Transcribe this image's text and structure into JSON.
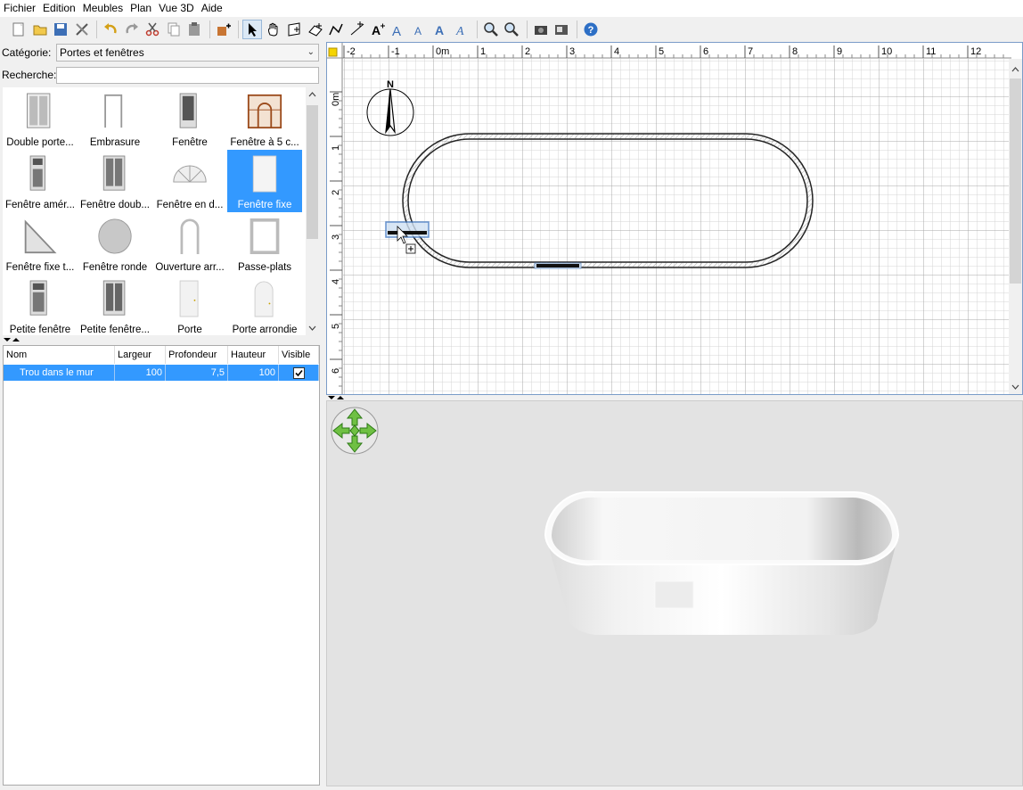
{
  "menu": [
    "Fichier",
    "Edition",
    "Meubles",
    "Plan",
    "Vue 3D",
    "Aide"
  ],
  "toolbar_icons": [
    "new-home-icon",
    "open-icon",
    "save-icon",
    "preferences-icon",
    "undo-icon",
    "redo-icon",
    "cut-icon",
    "copy-icon",
    "paste-icon",
    "add-furniture-icon",
    "select-mode-icon",
    "pan-mode-icon",
    "create-walls-icon",
    "create-rooms-icon",
    "create-polylines-icon",
    "create-dimensions-icon",
    "add-text-icon",
    "increase-text-size-icon",
    "decrease-text-size-icon",
    "bold-text-icon",
    "italic-text-icon",
    "zoom-in-icon",
    "zoom-out-icon",
    "create-photo-icon",
    "create-video-icon",
    "help-icon"
  ],
  "catalog": {
    "category_label": "Catégorie:",
    "category_value": "Portes et fenêtres",
    "search_label": "Recherche:",
    "search_value": "",
    "items": [
      {
        "label": "Double porte...",
        "selected": false
      },
      {
        "label": "Embrasure",
        "selected": false
      },
      {
        "label": "Fenêtre",
        "selected": false
      },
      {
        "label": "Fenêtre à 5 c...",
        "selected": false
      },
      {
        "label": "Fenêtre amér...",
        "selected": false
      },
      {
        "label": "Fenêtre doub...",
        "selected": false
      },
      {
        "label": "Fenêtre en d...",
        "selected": false
      },
      {
        "label": "Fenêtre fixe",
        "selected": true
      },
      {
        "label": "Fenêtre fixe t...",
        "selected": false
      },
      {
        "label": "Fenêtre ronde",
        "selected": false
      },
      {
        "label": "Ouverture arr...",
        "selected": false
      },
      {
        "label": "Passe-plats",
        "selected": false
      },
      {
        "label": "Petite fenêtre",
        "selected": false
      },
      {
        "label": "Petite fenêtre...",
        "selected": false
      },
      {
        "label": "Porte",
        "selected": false
      },
      {
        "label": "Porte arrondie",
        "selected": false
      }
    ]
  },
  "furniture_table": {
    "headers": [
      "Nom",
      "Largeur",
      "Profondeur",
      "Hauteur",
      "Visible"
    ],
    "rows": [
      {
        "name": "Trou dans le mur",
        "width": "100",
        "depth": "7,5",
        "height": "100",
        "visible": true
      }
    ]
  },
  "plan": {
    "ruler_x": [
      "-2",
      "-1",
      "0m",
      "1",
      "2",
      "3",
      "4",
      "5",
      "6",
      "7",
      "8",
      "9",
      "10",
      "11",
      "12"
    ],
    "ruler_y": [
      "0m",
      "1",
      "2",
      "3",
      "4",
      "5",
      "6"
    ],
    "compass_label": "N"
  }
}
